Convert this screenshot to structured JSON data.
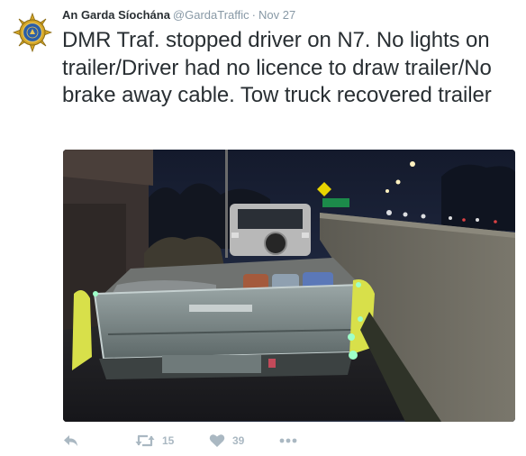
{
  "tweet": {
    "author": {
      "name": "An Garda Síochána",
      "handle": "@GardaTraffic",
      "separator": "·",
      "time": "Nov 27"
    },
    "text": "DMR Traf. stopped driver on N7. No lights on trailer/Driver had no licence to draw trailer/No brake away cable. Tow truck recovered trailer",
    "actions": {
      "retweet_count": "15",
      "like_count": "39"
    }
  },
  "colors": {
    "text": "#292f33",
    "muted": "#8899a6",
    "action_icon": "#aab8c2",
    "badge_gold": "#d4a627",
    "badge_blue": "#2a5ea8"
  },
  "icons": {
    "avatar": "garda-badge-icon",
    "reply": "reply-icon",
    "retweet": "retweet-icon",
    "like": "heart-icon",
    "more": "more-icon"
  }
}
